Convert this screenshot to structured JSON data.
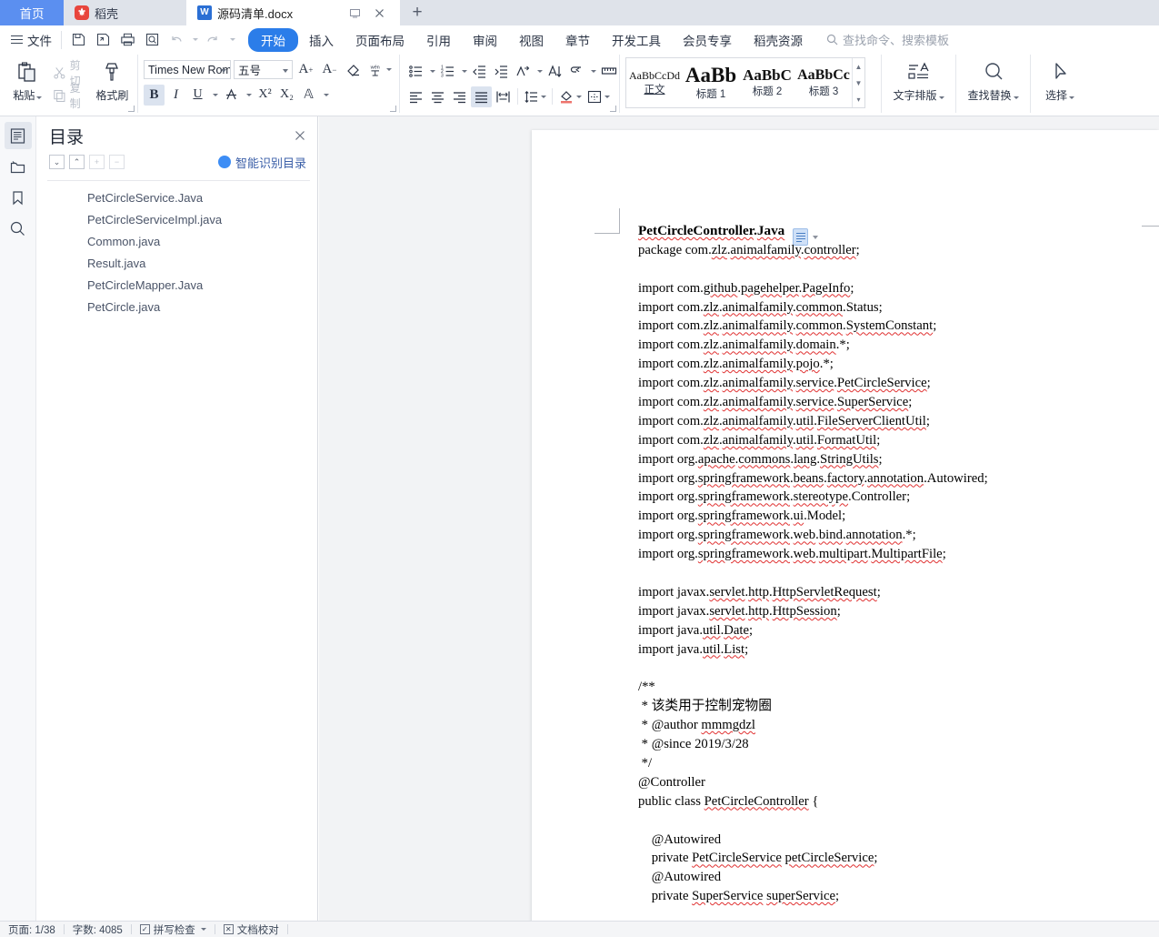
{
  "tabbar": {
    "home_tab": "首页",
    "docer_tab": "稻壳",
    "docer_icon": "docer-logo-icon",
    "doc_tab": "源码清单.docx",
    "doc_icon": "wps-writer-icon",
    "restore_icon": "restore-window-icon",
    "close_icon": "close-tab-icon",
    "new_tab": "+"
  },
  "menubar": {
    "file_label": "文件",
    "quick_access": [
      {
        "name": "save-icon",
        "glyph": "save"
      },
      {
        "name": "save-as-icon",
        "glyph": "saveas"
      },
      {
        "name": "print-icon",
        "glyph": "print"
      },
      {
        "name": "print-preview-icon",
        "glyph": "preview"
      },
      {
        "name": "undo-icon",
        "glyph": "undo"
      },
      {
        "name": "redo-icon",
        "glyph": "redo"
      },
      {
        "name": "customize-qat-icon",
        "glyph": "caret"
      }
    ],
    "items": [
      {
        "label": "开始",
        "active": true
      },
      {
        "label": "插入",
        "active": false
      },
      {
        "label": "页面布局",
        "active": false
      },
      {
        "label": "引用",
        "active": false
      },
      {
        "label": "审阅",
        "active": false
      },
      {
        "label": "视图",
        "active": false
      },
      {
        "label": "章节",
        "active": false
      },
      {
        "label": "开发工具",
        "active": false
      },
      {
        "label": "会员专享",
        "active": false
      },
      {
        "label": "稻壳资源",
        "active": false
      }
    ],
    "search_placeholder": "查找命令、搜索模板"
  },
  "ribbon": {
    "clipboard": {
      "paste_label": "粘贴",
      "cut_label": "剪切",
      "copy_label": "复制",
      "format_painter_label": "格式刷"
    },
    "font": {
      "family_value": "Times New Roma",
      "size_value": "五号",
      "bold_label": "B",
      "italic_label": "I",
      "underline_label": "U",
      "strike_label": "A",
      "superscript_label": "X²",
      "subscript_label": "X₂",
      "char_shade_label": "A",
      "grow_font_label": "A⁺",
      "shrink_font_label": "A⁻",
      "clear_format_label": "⬦",
      "pinyin_label": "wén",
      "highlight_label": "highlight",
      "font_color_label": "A"
    },
    "paragraph": {
      "bullets": "bullet-list",
      "numbering": "numbered-list",
      "decrease_indent": "decrease-indent",
      "increase_indent": "increase-indent",
      "multilevel": "multilevel-list",
      "sort": "sort",
      "show_marks": "show-paragraph-marks",
      "ruler": "ruler",
      "align_left": "align-left",
      "align_center": "align-center",
      "align_right": "align-right",
      "align_justify": "align-justify",
      "distribute": "distribute-text",
      "line_spacing": "line-spacing",
      "shading": "shading",
      "borders": "borders"
    },
    "styles": [
      {
        "sample": "AaBbCcDd",
        "size": "12px",
        "weight": "normal",
        "name": "正文"
      },
      {
        "sample": "AaBb",
        "size": "22px",
        "weight": "bold",
        "name": "标题 1"
      },
      {
        "sample": "AaBbC",
        "size": "17px",
        "weight": "bold",
        "name": "标题 2"
      },
      {
        "sample": "AaBbCc",
        "size": "15px",
        "weight": "bold",
        "name": "标题 3"
      }
    ],
    "right_tools": [
      {
        "label": "文字排版",
        "name": "text-typesetting"
      },
      {
        "label": "查找替换",
        "name": "find-replace"
      },
      {
        "label": "选择",
        "name": "select-tool"
      }
    ]
  },
  "rail": {
    "items": [
      {
        "name": "outline-icon",
        "active": true
      },
      {
        "name": "folder-icon",
        "active": false
      },
      {
        "name": "bookmark-icon",
        "active": false
      },
      {
        "name": "search-icon",
        "active": false
      }
    ]
  },
  "navpane": {
    "title": "目录",
    "close_icon": "close-pane-icon",
    "tools": [
      {
        "name": "collapse-down-button",
        "glyph": "⌄",
        "dim": false
      },
      {
        "name": "collapse-up-button",
        "glyph": "⌃",
        "dim": false
      },
      {
        "name": "expand-all-button",
        "glyph": "+",
        "dim": true
      },
      {
        "name": "collapse-all-button",
        "glyph": "−",
        "dim": true
      }
    ],
    "smart_toc_label": "智能识别目录",
    "items": [
      "PetCircleService.Java",
      "PetCircleServiceImpl.java",
      "Common.java",
      "Result.java",
      "PetCircleMapper.Java",
      "PetCircle.java"
    ]
  },
  "document": {
    "paste_badge": "paste-options-icon",
    "lines": [
      {
        "text": "PetCircleController.Java",
        "heading": true,
        "spell": true
      },
      {
        "text": "package com.zlz.animalfamily.controller;",
        "spell": true
      },
      {
        "text": "",
        "blank": true
      },
      {
        "text": "import com.github.pagehelper.PageInfo;",
        "spell": true
      },
      {
        "text": "import com.zlz.animalfamily.common.Status;",
        "spell": true
      },
      {
        "text": "import com.zlz.animalfamily.common.SystemConstant;",
        "spell": true
      },
      {
        "text": "import com.zlz.animalfamily.domain.*;",
        "spell": true
      },
      {
        "text": "import com.zlz.animalfamily.pojo.*;",
        "spell": true
      },
      {
        "text": "import com.zlz.animalfamily.service.PetCircleService;",
        "spell": true
      },
      {
        "text": "import com.zlz.animalfamily.service.SuperService;",
        "spell": true
      },
      {
        "text": "import com.zlz.animalfamily.util.FileServerClientUtil;",
        "spell": true
      },
      {
        "text": "import com.zlz.animalfamily.util.FormatUtil;",
        "spell": true
      },
      {
        "text": "import org.apache.commons.lang.StringUtils;",
        "spell": true
      },
      {
        "text": "import org.springframework.beans.factory.annotation.Autowired;",
        "spell": true
      },
      {
        "text": "import org.springframework.stereotype.Controller;",
        "spell": true
      },
      {
        "text": "import org.springframework.ui.Model;",
        "spell": true
      },
      {
        "text": "import org.springframework.web.bind.annotation.*;",
        "spell": true
      },
      {
        "text": "import org.springframework.web.multipart.MultipartFile;",
        "spell": true
      },
      {
        "text": "",
        "blank": true
      },
      {
        "text": "import javax.servlet.http.HttpServletRequest;",
        "spell": true
      },
      {
        "text": "import javax.servlet.http.HttpSession;",
        "spell": true
      },
      {
        "text": "import java.util.Date;",
        "spell": true
      },
      {
        "text": "import java.util.List;",
        "spell": true
      },
      {
        "text": "",
        "blank": true
      },
      {
        "text": "/**",
        "spell": false
      },
      {
        "text": " * 该类用于控制宠物圈",
        "spell": false
      },
      {
        "text": " * @author mmmgdzl",
        "spell": true
      },
      {
        "text": " * @since 2019/3/28",
        "spell": false
      },
      {
        "text": " */",
        "spell": false
      },
      {
        "text": "@Controller",
        "spell": false
      },
      {
        "text": "public class PetCircleController {",
        "spell": true
      },
      {
        "text": "",
        "blank": true
      },
      {
        "text": "    @Autowired",
        "spell": true
      },
      {
        "text": "    private PetCircleService petCircleService;",
        "spell": true
      },
      {
        "text": "    @Autowired",
        "spell": true
      },
      {
        "text": "    private SuperService superService;",
        "spell": true
      }
    ]
  },
  "statusbar": {
    "page_label": "页面: 1/38",
    "word_count_label": "字数: 4085",
    "spellcheck_label": "拼写检查",
    "spellcheck_icon": "checkbox-check-icon",
    "proofread_label": "文档校对",
    "proofread_icon": "checkbox-x-icon"
  }
}
